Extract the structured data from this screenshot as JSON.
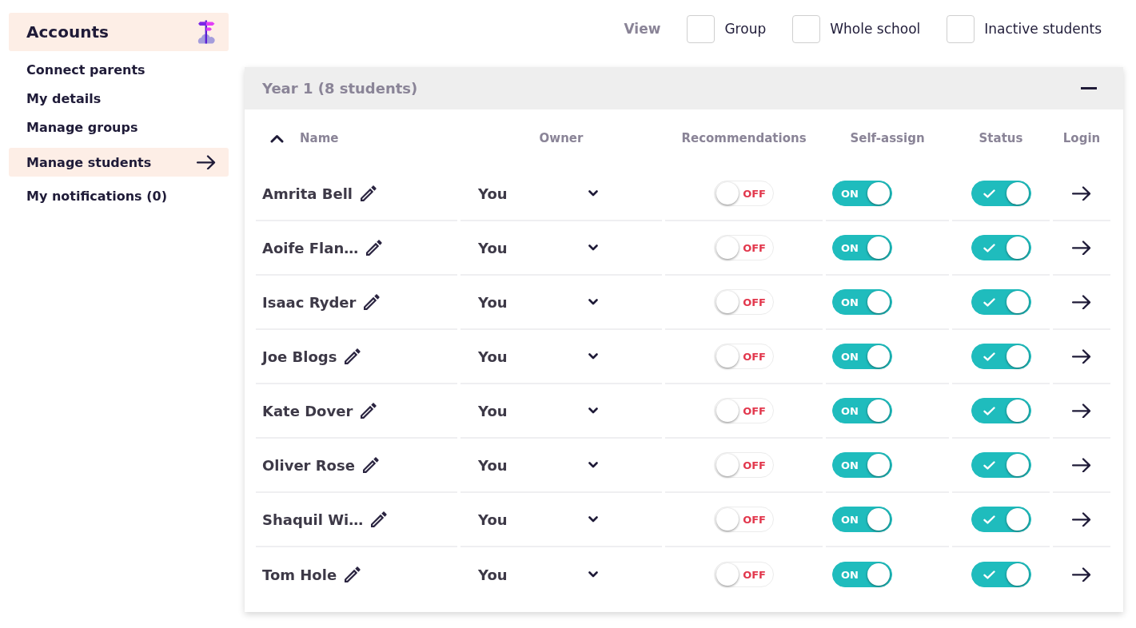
{
  "sidebar": {
    "title": "Accounts",
    "items": [
      {
        "label": "Connect parents",
        "selected": false
      },
      {
        "label": "My details",
        "selected": false
      },
      {
        "label": "Manage groups",
        "selected": false
      },
      {
        "label": "Manage students",
        "selected": true
      },
      {
        "label": "My notifications (0)",
        "selected": false
      }
    ]
  },
  "view_filter": {
    "label": "View",
    "options": [
      {
        "label": "Group",
        "checked": false
      },
      {
        "label": "Whole school",
        "checked": false
      },
      {
        "label": "Inactive students",
        "checked": false
      }
    ]
  },
  "group": {
    "title": "Year 1 (8 students)",
    "expanded": true,
    "columns": [
      {
        "label": "Name",
        "sorted": true
      },
      {
        "label": "Owner",
        "sorted": false
      },
      {
        "label": "Recommendations",
        "sorted": false
      },
      {
        "label": "Self-assign",
        "sorted": false
      },
      {
        "label": "Status",
        "sorted": false
      },
      {
        "label": "Login",
        "sorted": false
      }
    ],
    "rows": [
      {
        "name": "Amrita Bell",
        "owner": "You",
        "recommendations": {
          "on": false,
          "label": "OFF"
        },
        "self_assign": {
          "on": true,
          "label": "ON"
        },
        "status": {
          "on": true
        }
      },
      {
        "name": "Aoife Flan…",
        "owner": "You",
        "recommendations": {
          "on": false,
          "label": "OFF"
        },
        "self_assign": {
          "on": true,
          "label": "ON"
        },
        "status": {
          "on": true
        }
      },
      {
        "name": "Isaac Ryder",
        "owner": "You",
        "recommendations": {
          "on": false,
          "label": "OFF"
        },
        "self_assign": {
          "on": true,
          "label": "ON"
        },
        "status": {
          "on": true
        }
      },
      {
        "name": "Joe Blogs",
        "owner": "You",
        "recommendations": {
          "on": false,
          "label": "OFF"
        },
        "self_assign": {
          "on": true,
          "label": "ON"
        },
        "status": {
          "on": true
        }
      },
      {
        "name": "Kate Dover",
        "owner": "You",
        "recommendations": {
          "on": false,
          "label": "OFF"
        },
        "self_assign": {
          "on": true,
          "label": "ON"
        },
        "status": {
          "on": true
        }
      },
      {
        "name": "Oliver Rose",
        "owner": "You",
        "recommendations": {
          "on": false,
          "label": "OFF"
        },
        "self_assign": {
          "on": true,
          "label": "ON"
        },
        "status": {
          "on": true
        }
      },
      {
        "name": "Shaquil Wi…",
        "owner": "You",
        "recommendations": {
          "on": false,
          "label": "OFF"
        },
        "self_assign": {
          "on": true,
          "label": "ON"
        },
        "status": {
          "on": true
        }
      },
      {
        "name": "Tom Hole",
        "owner": "You",
        "recommendations": {
          "on": false,
          "label": "OFF"
        },
        "self_assign": {
          "on": true,
          "label": "ON"
        },
        "status": {
          "on": true
        }
      }
    ]
  }
}
